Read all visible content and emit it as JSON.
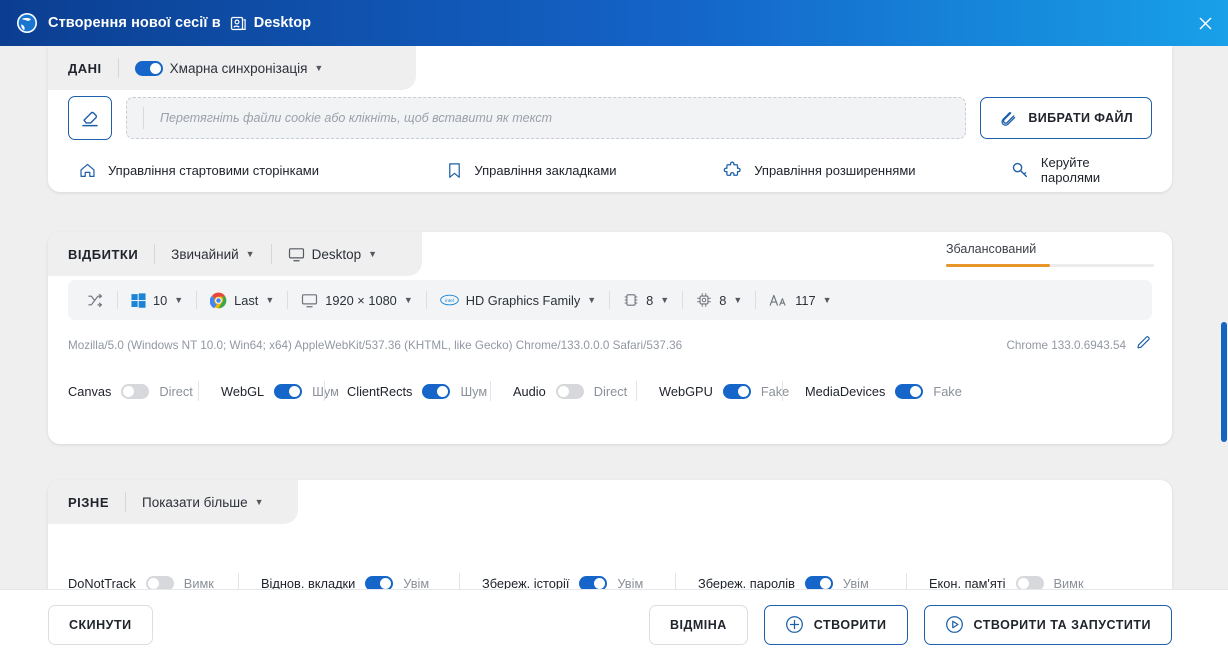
{
  "titlebar": {
    "title": "Створення нової сесії в",
    "profile": "Desktop",
    "logo_icon": "globe-logo-icon",
    "window_icon": "profile-window-icon",
    "close_icon": "close-icon"
  },
  "data_section": {
    "title": "ДАНІ",
    "cloud_sync": {
      "label": "Хмарна синхронізація",
      "state": "on",
      "caret": "▼"
    },
    "erase_icon": "eraser-icon",
    "dropzone_placeholder": "Перетягніть файли cookie або клікніть, щоб вставити як текст",
    "pick_file": {
      "label": "ВИБРАТИ ФАЙЛ",
      "icon": "paperclip-icon"
    },
    "links": [
      {
        "label": "Управління стартовими сторінками",
        "icon": "home-icon"
      },
      {
        "label": "Управління закладками",
        "icon": "bookmark-icon"
      },
      {
        "label": "Управління розширеннями",
        "icon": "puzzle-icon"
      },
      {
        "label": "Керуйте паролями",
        "icon": "key-icon"
      }
    ]
  },
  "prints_section": {
    "title": "ВІДБИТКИ",
    "mode": {
      "label": "Звичайний",
      "caret": "▼"
    },
    "platform": {
      "label": "Desktop",
      "icon": "monitor-icon",
      "caret": "▼"
    },
    "balanced": {
      "label": "Збалансований",
      "progress": 50,
      "color": "#e8952a"
    },
    "chips": [
      {
        "name": "shuffle",
        "label": "",
        "icon": "shuffle-icon",
        "caret": ""
      },
      {
        "name": "os",
        "label": "10",
        "icon": "windows-icon",
        "caret": "▼"
      },
      {
        "name": "browser",
        "label": "Last",
        "icon": "chrome-icon",
        "caret": "▼"
      },
      {
        "name": "resolution",
        "label": "1920 × 1080",
        "icon": "monitor-icon",
        "caret": "▼"
      },
      {
        "name": "gpu",
        "label": "HD Graphics Family",
        "icon": "intel-icon",
        "caret": "▼"
      },
      {
        "name": "ram",
        "label": "8",
        "icon": "memory-icon",
        "caret": "▼"
      },
      {
        "name": "cpu",
        "label": "8",
        "icon": "cpu-icon",
        "caret": "▼"
      },
      {
        "name": "fonts",
        "label": "117",
        "icon": "fonts-icon",
        "caret": "▼"
      }
    ],
    "user_agent": "Mozilla/5.0 (Windows NT 10.0; Win64; x64) AppleWebKit/537.36 (KHTML, like Gecko) Chrome/133.0.0.0 Safari/537.36",
    "browser_version": "Chrome 133.0.6943.54",
    "edit_icon": "pencil-icon",
    "flags": [
      {
        "name": "Canvas",
        "state": "off",
        "value": "Direct"
      },
      {
        "name": "WebGL",
        "state": "on",
        "value": "Шум"
      },
      {
        "name": "ClientRects",
        "state": "on",
        "value": "Шум"
      },
      {
        "name": "Audio",
        "state": "off",
        "value": "Direct"
      },
      {
        "name": "WebGPU",
        "state": "on",
        "value": "Fake"
      },
      {
        "name": "MediaDevices",
        "state": "on",
        "value": "Fake"
      }
    ]
  },
  "misc_section": {
    "title": "РІЗНЕ",
    "show_more": {
      "label": "Показати більше",
      "caret": "▼"
    },
    "flags": [
      {
        "name": "DoNotTrack",
        "state": "off",
        "value": "Вимк"
      },
      {
        "name": "Віднов",
        "state": "on",
        "value": "Увім"
      },
      {
        "name": "Збереж. історії",
        "state": "on",
        "value": "Увім"
      },
      {
        "name": "Збереж. паролів",
        "state": "on",
        "value": "Увім"
      },
      {
        "name": "Екон. пам'яті",
        "state": "off",
        "value": "Вимк"
      }
    ],
    "flag_names": [
      "DoNotTrack",
      "Віднов. вкладки",
      "Збереж. історії",
      "Збереж. паролів",
      "Екон. пам'яті"
    ]
  },
  "footer": {
    "reset": "СКИНУТИ",
    "cancel": "ВІДМІНА",
    "create": {
      "label": "СТВОРИТИ",
      "icon": "plus-circle-icon"
    },
    "create_run": {
      "label": "СТВОРИТИ ТА ЗАПУСТИТИ",
      "icon": "play-circle-icon"
    }
  },
  "colors": {
    "accent": "#1565c0",
    "title_gradient_start": "#0b3e91",
    "title_gradient_end": "#18a0e8",
    "orange": "#e8952a"
  }
}
